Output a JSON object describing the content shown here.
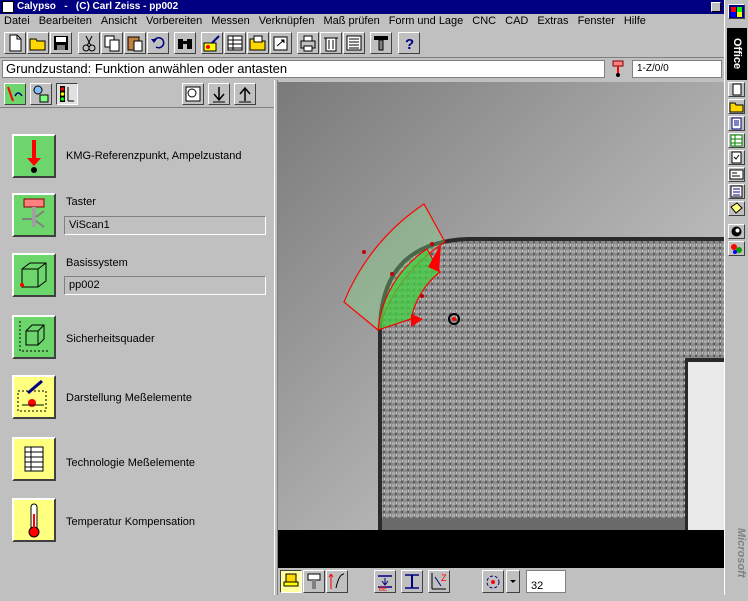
{
  "window": {
    "title": "Calypso   -   (C) Carl Zeiss - pp002"
  },
  "menu": [
    {
      "label": "Datei"
    },
    {
      "label": "Bearbeiten"
    },
    {
      "label": "Ansicht"
    },
    {
      "label": "Vorbereiten"
    },
    {
      "label": "Messen"
    },
    {
      "label": "Verknüpfen"
    },
    {
      "label": "Maß prüfen"
    },
    {
      "label": "Form und Lage"
    },
    {
      "label": "CNC"
    },
    {
      "label": "CAD"
    },
    {
      "label": "Extras"
    },
    {
      "label": "Fenster"
    },
    {
      "label": "Hilfe"
    }
  ],
  "status": {
    "message": "Grundzustand: Funktion anwählen oder antasten",
    "coord": "1-Z/0/0"
  },
  "panel": {
    "items": [
      {
        "label": "KMG-Referenzpunkt, Ampelzustand"
      },
      {
        "label": "Taster",
        "value": "ViScan1"
      },
      {
        "label": "Basissystem",
        "value": "pp002"
      },
      {
        "label": "Sicherheitsquader"
      },
      {
        "label": "Darstellung Meßelemente"
      },
      {
        "label": "Technologie Meßelemente"
      },
      {
        "label": "Temperatur Kompensation"
      }
    ]
  },
  "bottom": {
    "value": "32"
  },
  "office": {
    "title": "Office",
    "logo": "Microsoft"
  },
  "colors": {
    "titlebar": "#000080",
    "tile_green": "#6cd66c",
    "tile_yellow": "#ffff80",
    "probe_arc": "#ff0000",
    "probe_fill": "#40d040"
  }
}
